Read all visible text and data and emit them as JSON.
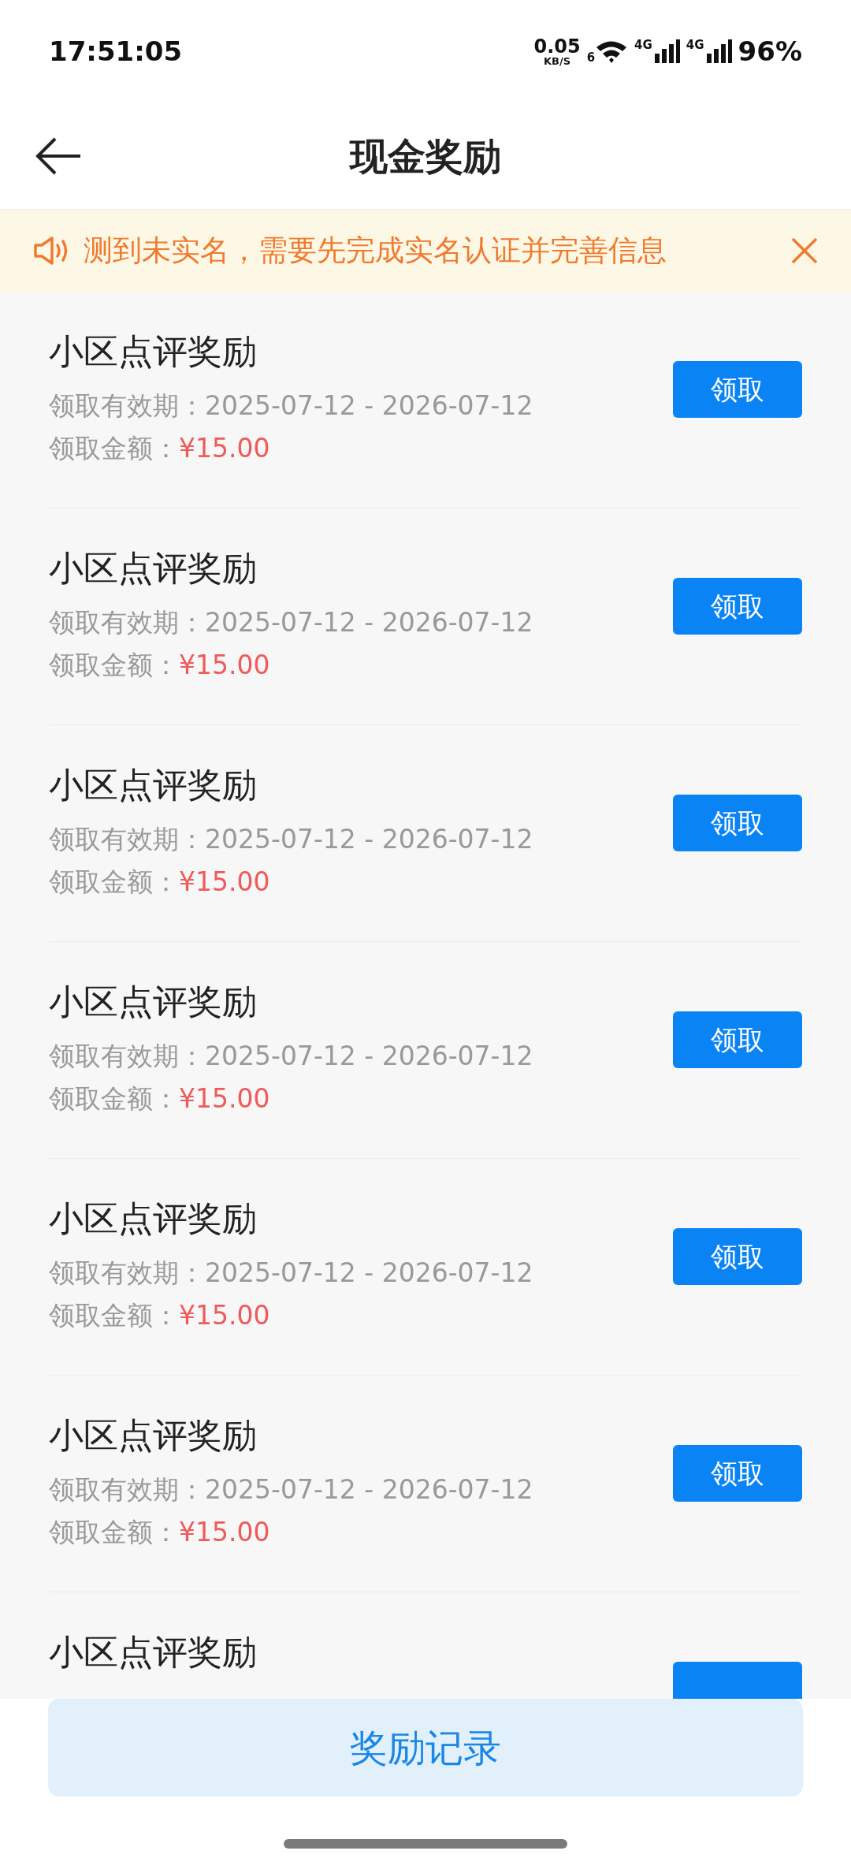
{
  "status_bar": {
    "time": "17:51:05",
    "network_speed": "0.05",
    "speed_unit": "KB/S",
    "wifi_label": "6",
    "signals": [
      "4G",
      "4G"
    ],
    "battery": "96%"
  },
  "header": {
    "title": "现金奖励"
  },
  "notice": {
    "text": "测到未实名，需要先完成实名认证并完善信息"
  },
  "rewards": [
    {
      "title": "小区点评奖励",
      "validity_label": "领取有效期：",
      "validity": "2025-07-12 - 2026-07-12",
      "amount_label": "领取金额：",
      "amount": "¥15.00",
      "button": "领取"
    },
    {
      "title": "小区点评奖励",
      "validity_label": "领取有效期：",
      "validity": "2025-07-12 - 2026-07-12",
      "amount_label": "领取金额：",
      "amount": "¥15.00",
      "button": "领取"
    },
    {
      "title": "小区点评奖励",
      "validity_label": "领取有效期：",
      "validity": "2025-07-12 - 2026-07-12",
      "amount_label": "领取金额：",
      "amount": "¥15.00",
      "button": "领取"
    },
    {
      "title": "小区点评奖励",
      "validity_label": "领取有效期：",
      "validity": "2025-07-12 - 2026-07-12",
      "amount_label": "领取金额：",
      "amount": "¥15.00",
      "button": "领取"
    },
    {
      "title": "小区点评奖励",
      "validity_label": "领取有效期：",
      "validity": "2025-07-12 - 2026-07-12",
      "amount_label": "领取金额：",
      "amount": "¥15.00",
      "button": "领取"
    },
    {
      "title": "小区点评奖励",
      "validity_label": "领取有效期：",
      "validity": "2025-07-12 - 2026-07-12",
      "amount_label": "领取金额：",
      "amount": "¥15.00",
      "button": "领取"
    },
    {
      "title": "小区点评奖励"
    }
  ],
  "bottom_button": "奖励记录"
}
